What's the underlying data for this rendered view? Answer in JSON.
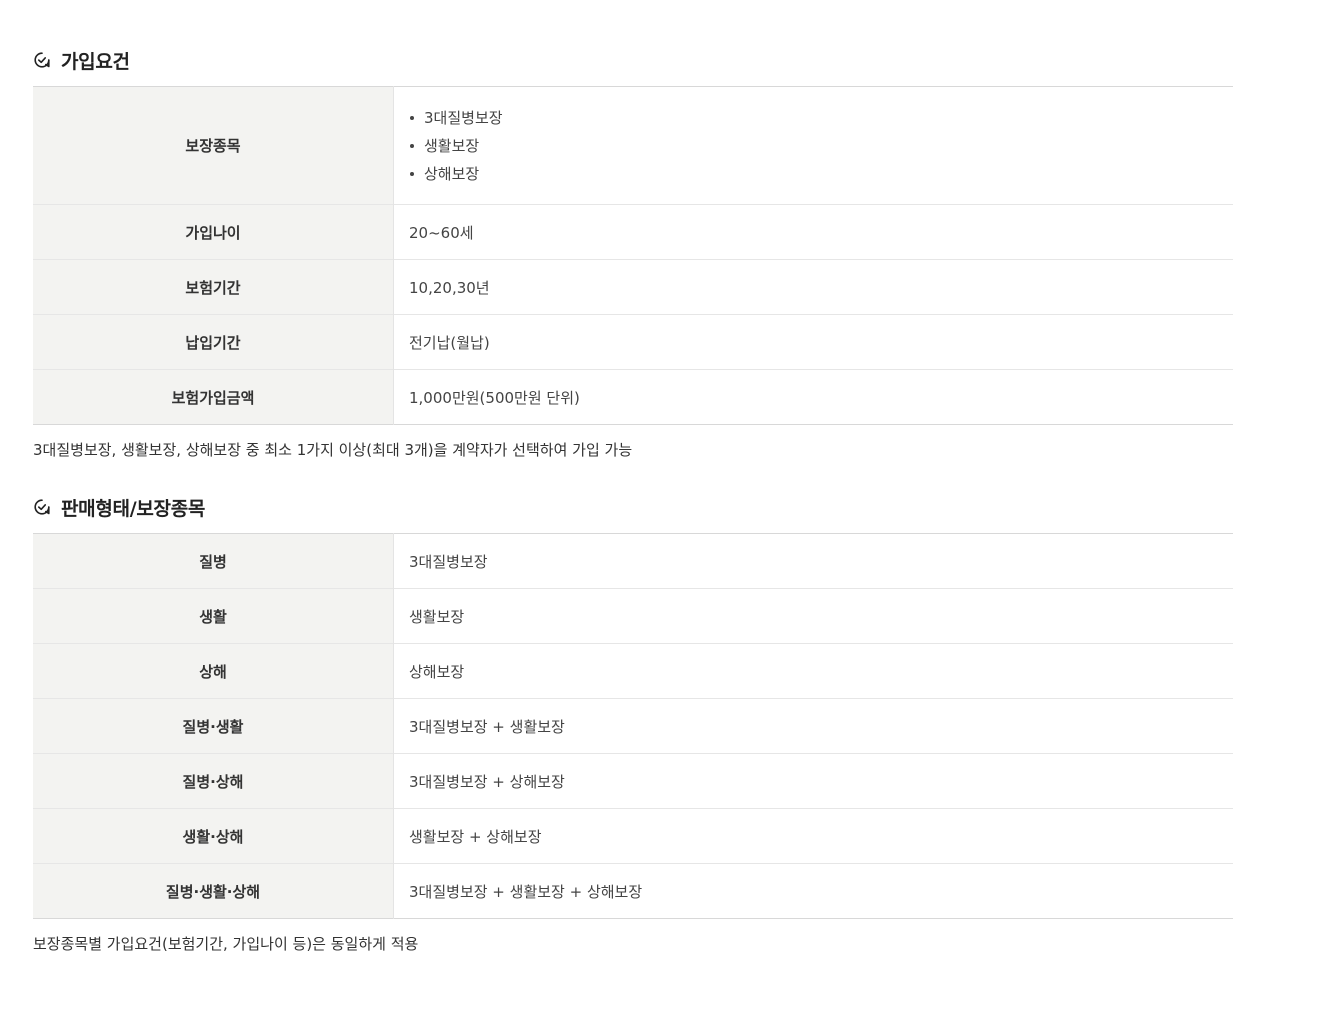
{
  "section1": {
    "title": "가입요건",
    "rows": {
      "coverage": {
        "label": "보장종목",
        "items": [
          "3대질병보장",
          "생활보장",
          "상해보장"
        ]
      },
      "age": {
        "label": "가입나이",
        "value": "20~60세"
      },
      "term": {
        "label": "보험기간",
        "value": "10,20,30년"
      },
      "payment": {
        "label": "납입기간",
        "value": "전기납(월납)"
      },
      "amount": {
        "label": "보험가입금액",
        "value": "1,000만원(500만원 단위)"
      }
    },
    "note": "3대질병보장, 생활보장, 상해보장 중 최소 1가지 이상(최대 3개)을 계약자가 선택하여 가입 가능"
  },
  "section2": {
    "title": "판매형태/보장종목",
    "rows": [
      {
        "label": "질병",
        "value": "3대질병보장"
      },
      {
        "label": "생활",
        "value": "생활보장"
      },
      {
        "label": "상해",
        "value": "상해보장"
      },
      {
        "label": "질병·생활",
        "value": "3대질병보장 + 생활보장"
      },
      {
        "label": "질병·상해",
        "value": "3대질병보장 + 상해보장"
      },
      {
        "label": "생활·상해",
        "value": "생활보장 + 상해보장"
      },
      {
        "label": "질병·생활·상해",
        "value": "3대질병보장 + 생활보장 + 상해보장"
      }
    ],
    "note": "보장종목별 가입요건(보험기간, 가입나이 등)은 동일하게 적용"
  },
  "icons": {
    "section_icon": "check-circle-icon"
  }
}
